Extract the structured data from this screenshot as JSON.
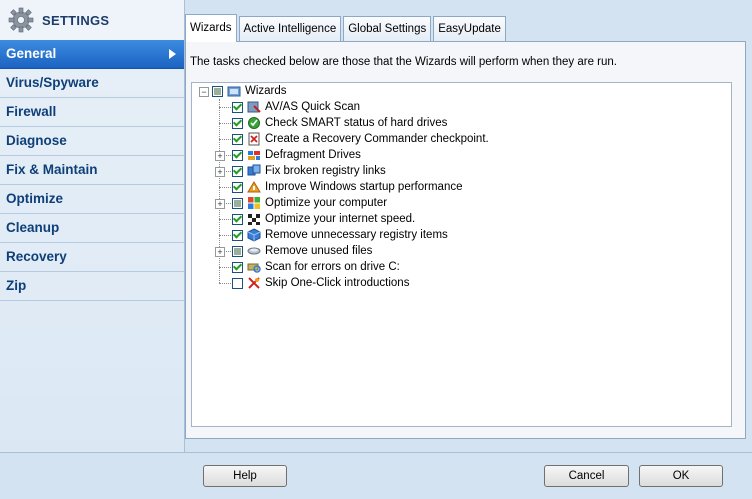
{
  "sidebar": {
    "title": "SETTINGS",
    "items": [
      {
        "label": "General",
        "active": true
      },
      {
        "label": "Virus/Spyware"
      },
      {
        "label": "Firewall"
      },
      {
        "label": "Diagnose"
      },
      {
        "label": "Fix & Maintain"
      },
      {
        "label": "Optimize"
      },
      {
        "label": "Cleanup"
      },
      {
        "label": "Recovery"
      },
      {
        "label": "Zip"
      }
    ]
  },
  "tabs": [
    {
      "label": "Wizards",
      "active": true
    },
    {
      "label": "Active Intelligence"
    },
    {
      "label": "Global Settings"
    },
    {
      "label": "EasyUpdate"
    }
  ],
  "description": "The tasks checked below are those that the Wizards will perform when they are run.",
  "tree": {
    "root": {
      "label": "Wizards",
      "state": "partial",
      "icon": "wizard-icon"
    },
    "items": [
      {
        "label": "AV/AS Quick Scan",
        "state": "checked",
        "expandable": false,
        "icon": "scan-icon"
      },
      {
        "label": "Check SMART status of hard drives",
        "state": "checked",
        "expandable": false,
        "icon": "smart-check-icon"
      },
      {
        "label": "Create a Recovery Commander checkpoint.",
        "state": "checked",
        "expandable": false,
        "icon": "checkpoint-icon"
      },
      {
        "label": "Defragment Drives",
        "state": "checked",
        "expandable": true,
        "icon": "defrag-icon"
      },
      {
        "label": "Fix broken registry links",
        "state": "checked",
        "expandable": true,
        "icon": "registry-icon"
      },
      {
        "label": "Improve Windows startup performance",
        "state": "checked",
        "expandable": false,
        "icon": "startup-icon"
      },
      {
        "label": "Optimize your computer",
        "state": "partial",
        "expandable": true,
        "icon": "windows-icon"
      },
      {
        "label": "Optimize your internet speed.",
        "state": "checked",
        "expandable": false,
        "icon": "internet-speed-icon"
      },
      {
        "label": "Remove unnecessary registry items",
        "state": "checked",
        "expandable": false,
        "icon": "registry-cube-icon"
      },
      {
        "label": "Remove unused files",
        "state": "partial",
        "expandable": true,
        "icon": "files-icon"
      },
      {
        "label": "Scan for errors on drive C:",
        "state": "checked",
        "expandable": false,
        "icon": "drive-scan-icon"
      },
      {
        "label": "Skip One-Click introductions",
        "state": "unchecked",
        "expandable": false,
        "icon": "skip-icon"
      }
    ]
  },
  "footer": {
    "help": "Help",
    "cancel": "Cancel",
    "ok": "OK"
  }
}
